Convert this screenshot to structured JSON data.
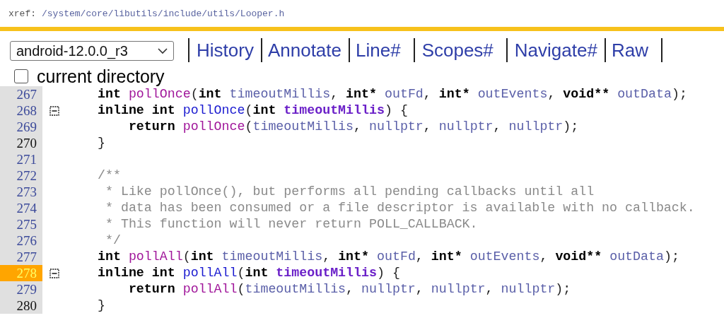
{
  "header": {
    "label": "xref:",
    "path": "/system/core/libutils/include/utils/Looper.h"
  },
  "nav": {
    "version": "android-12.0.0_r3",
    "links": [
      "History",
      "Annotate",
      "Line#",
      "Scopes#",
      "Navigate#",
      "Raw"
    ]
  },
  "current_directory": {
    "label": "current directory",
    "checked": false
  },
  "lines": [
    {
      "number": "267",
      "kind": "l",
      "selected": false,
      "fold": false,
      "tokens": [
        {
          "kind": "keyword",
          "text": "int "
        },
        {
          "kind": "call",
          "text": "pollOnce"
        },
        {
          "kind": "plain",
          "text": "("
        },
        {
          "kind": "keyword",
          "text": "int "
        },
        {
          "kind": "ident",
          "text": "timeoutMillis"
        },
        {
          "kind": "plain",
          "text": ", "
        },
        {
          "kind": "keyword",
          "text": "int* "
        },
        {
          "kind": "ident",
          "text": "outFd"
        },
        {
          "kind": "plain",
          "text": ", "
        },
        {
          "kind": "keyword",
          "text": "int* "
        },
        {
          "kind": "ident",
          "text": "outEvents"
        },
        {
          "kind": "plain",
          "text": ", "
        },
        {
          "kind": "keyword",
          "text": "void** "
        },
        {
          "kind": "ident",
          "text": "outData"
        },
        {
          "kind": "plain",
          "text": ");"
        }
      ]
    },
    {
      "number": "268",
      "kind": "l",
      "selected": false,
      "fold": true,
      "tokens": [
        {
          "kind": "keyword",
          "text": "inline int "
        },
        {
          "kind": "def",
          "text": "pollOnce"
        },
        {
          "kind": "plain",
          "text": "("
        },
        {
          "kind": "keyword",
          "text": "int "
        },
        {
          "kind": "param",
          "text": "timeoutMillis"
        },
        {
          "kind": "plain",
          "text": ") {"
        }
      ]
    },
    {
      "number": "269",
      "kind": "l",
      "selected": false,
      "fold": false,
      "tokens": [
        {
          "kind": "keyword",
          "text": "    return "
        },
        {
          "kind": "call",
          "text": "pollOnce"
        },
        {
          "kind": "plain",
          "text": "("
        },
        {
          "kind": "ident",
          "text": "timeoutMillis"
        },
        {
          "kind": "plain",
          "text": ", "
        },
        {
          "kind": "ident",
          "text": "nullptr"
        },
        {
          "kind": "plain",
          "text": ", "
        },
        {
          "kind": "ident",
          "text": "nullptr"
        },
        {
          "kind": "plain",
          "text": ", "
        },
        {
          "kind": "ident",
          "text": "nullptr"
        },
        {
          "kind": "plain",
          "text": ");"
        }
      ]
    },
    {
      "number": "270",
      "kind": "hl",
      "selected": false,
      "fold": false,
      "tokens": [
        {
          "kind": "plain",
          "text": "}"
        }
      ]
    },
    {
      "number": "271",
      "kind": "l",
      "selected": false,
      "fold": false
    },
    {
      "number": "272",
      "kind": "l",
      "selected": false,
      "fold": false,
      "tokens": [
        {
          "kind": "comment",
          "text": "/**"
        }
      ]
    },
    {
      "number": "273",
      "kind": "l",
      "selected": false,
      "fold": false,
      "tokens": [
        {
          "kind": "comment",
          "text": " * Like pollOnce(), but performs all pending callbacks until all"
        }
      ]
    },
    {
      "number": "274",
      "kind": "l",
      "selected": false,
      "fold": false,
      "tokens": [
        {
          "kind": "comment",
          "text": " * data has been consumed or a file descriptor is available with no callback."
        }
      ]
    },
    {
      "number": "275",
      "kind": "l",
      "selected": false,
      "fold": false,
      "tokens": [
        {
          "kind": "comment",
          "text": " * This function will never return POLL_CALLBACK."
        }
      ]
    },
    {
      "number": "276",
      "kind": "l",
      "selected": false,
      "fold": false,
      "tokens": [
        {
          "kind": "comment",
          "text": " */"
        }
      ]
    },
    {
      "number": "277",
      "kind": "l",
      "selected": false,
      "fold": false,
      "tokens": [
        {
          "kind": "keyword",
          "text": "int "
        },
        {
          "kind": "call",
          "text": "pollAll"
        },
        {
          "kind": "plain",
          "text": "("
        },
        {
          "kind": "keyword",
          "text": "int "
        },
        {
          "kind": "ident",
          "text": "timeoutMillis"
        },
        {
          "kind": "plain",
          "text": ", "
        },
        {
          "kind": "keyword",
          "text": "int* "
        },
        {
          "kind": "ident",
          "text": "outFd"
        },
        {
          "kind": "plain",
          "text": ", "
        },
        {
          "kind": "keyword",
          "text": "int* "
        },
        {
          "kind": "ident",
          "text": "outEvents"
        },
        {
          "kind": "plain",
          "text": ", "
        },
        {
          "kind": "keyword",
          "text": "void** "
        },
        {
          "kind": "ident",
          "text": "outData"
        },
        {
          "kind": "plain",
          "text": ");"
        }
      ]
    },
    {
      "number": "278",
      "kind": "l",
      "selected": true,
      "fold": true,
      "tokens": [
        {
          "kind": "keyword",
          "text": "inline int "
        },
        {
          "kind": "def",
          "text": "pollAll"
        },
        {
          "kind": "plain",
          "text": "("
        },
        {
          "kind": "keyword",
          "text": "int "
        },
        {
          "kind": "param",
          "text": "timeoutMillis"
        },
        {
          "kind": "plain",
          "text": ") {"
        }
      ]
    },
    {
      "number": "279",
      "kind": "l",
      "selected": false,
      "fold": false,
      "tokens": [
        {
          "kind": "keyword",
          "text": "    return "
        },
        {
          "kind": "call",
          "text": "pollAll"
        },
        {
          "kind": "plain",
          "text": "("
        },
        {
          "kind": "ident",
          "text": "timeoutMillis"
        },
        {
          "kind": "plain",
          "text": ", "
        },
        {
          "kind": "ident",
          "text": "nullptr"
        },
        {
          "kind": "plain",
          "text": ", "
        },
        {
          "kind": "ident",
          "text": "nullptr"
        },
        {
          "kind": "plain",
          "text": ", "
        },
        {
          "kind": "ident",
          "text": "nullptr"
        },
        {
          "kind": "plain",
          "text": ");"
        }
      ]
    },
    {
      "number": "280",
      "kind": "hl",
      "selected": false,
      "fold": false,
      "tokens": [
        {
          "kind": "plain",
          "text": "}"
        }
      ]
    }
  ]
}
